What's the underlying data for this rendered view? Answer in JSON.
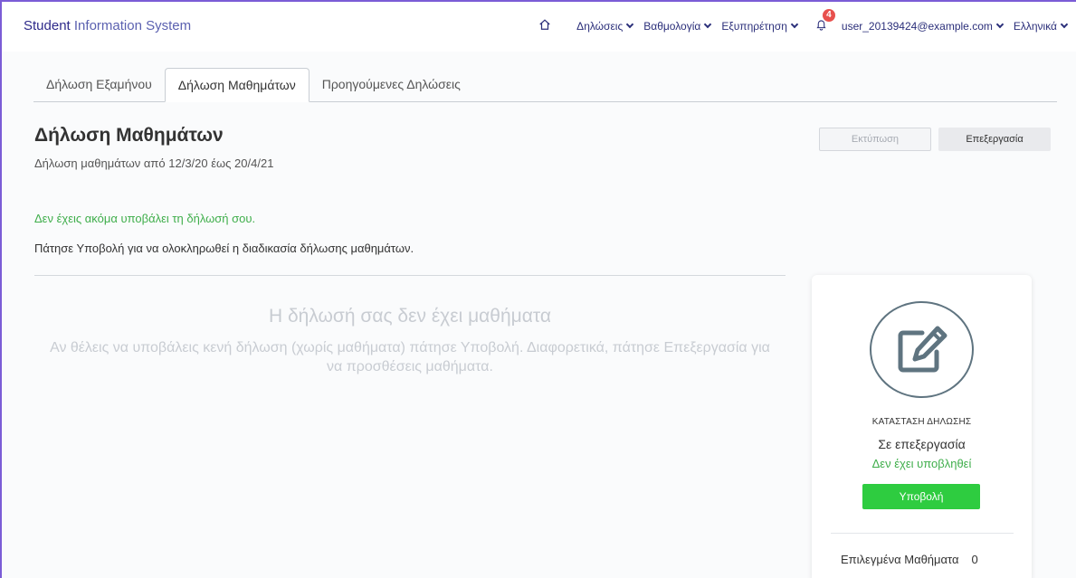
{
  "header": {
    "brand_strong": "Student",
    "brand_rest": " Information System",
    "nav": {
      "declarations": "Δηλώσεις",
      "grades": "Βαθμολογία",
      "support": "Εξυπηρέτηση",
      "notifications_count": "4",
      "user": "user_20139424@example.com",
      "language": "Ελληνικά"
    }
  },
  "tabs": [
    {
      "label": "Δήλωση Εξαμήνου"
    },
    {
      "label": "Δήλωση Μαθημάτων"
    },
    {
      "label": "Προηγούμενες Δηλώσεις"
    }
  ],
  "main": {
    "title": "Δήλωση Μαθημάτων",
    "subtitle": "Δήλωση μαθημάτων από 12/3/20 έως 20/4/21",
    "print_label": "Εκτύπωση",
    "edit_label": "Επεξεργασία",
    "not_submitted_msg": "Δεν έχεις ακόμα υποβάλει τη δήλωσή σου.",
    "instructions": "Πάτησε Υποβολή για να ολοκληρωθεί η διαδικασία δήλωσης μαθημάτων.",
    "empty_title": "Η δήλωσή σας δεν έχει μαθήματα",
    "empty_text": "Αν θέλεις να υποβάλεις κενή δήλωση (χωρίς μαθήματα) πάτησε Υποβολή. Διαφορετικά, πάτησε Επεξεργασία για να προσθέσεις μαθήματα."
  },
  "status_card": {
    "label": "ΚΑΤΑΣΤΑΣΗ ΔΗΛΩΣΗΣ",
    "status": "Σε επεξεργασία",
    "sub_status": "Δεν έχει υποβληθεί",
    "submit_label": "Υποβολή",
    "selected_courses_label": "Επιλεγμένα Μαθήματα",
    "selected_courses_count": "0"
  },
  "colors": {
    "accent": "#2b2f7a",
    "success": "#3fae4b",
    "submit": "#2ecc40",
    "frame": "#7b5cd6"
  }
}
